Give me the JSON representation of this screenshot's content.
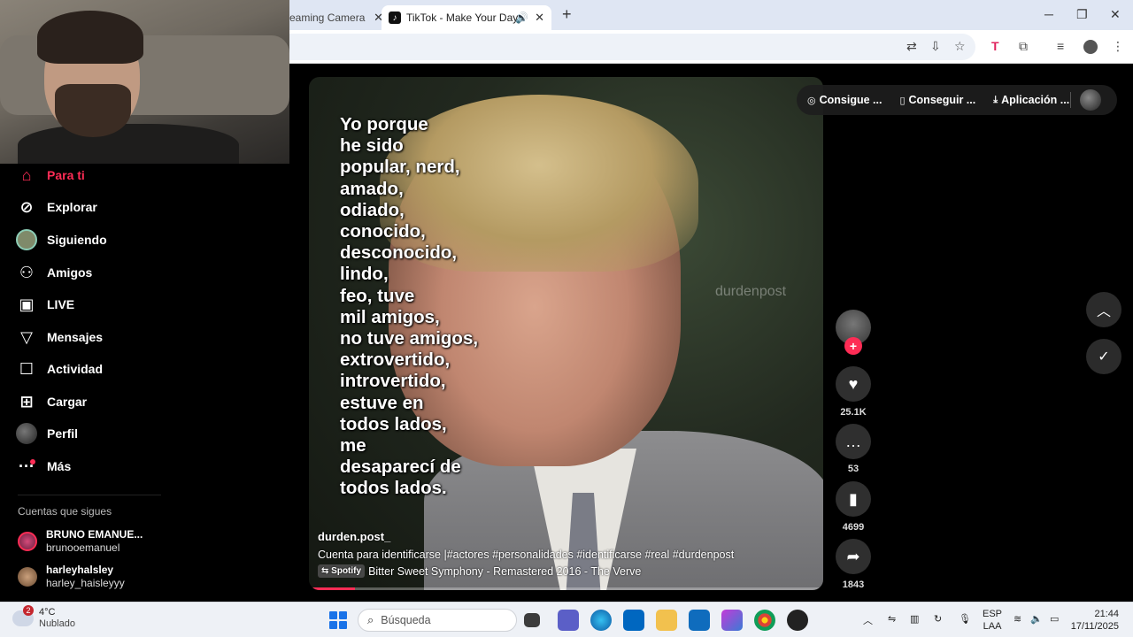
{
  "browser": {
    "tabs": [
      {
        "label": "eaming Camera",
        "active": false
      },
      {
        "label": "TikTok - Make Your Day",
        "active": true
      }
    ],
    "new_tab": "+",
    "window_controls": [
      "─",
      "❐",
      "✕"
    ]
  },
  "sidebar": {
    "items": [
      {
        "label": "Para ti",
        "icon": "home-icon"
      },
      {
        "label": "Explorar",
        "icon": "compass-icon"
      },
      {
        "label": "Siguiendo",
        "icon": "following-avatar"
      },
      {
        "label": "Amigos",
        "icon": "friends-icon"
      },
      {
        "label": "LIVE",
        "icon": "live-icon"
      },
      {
        "label": "Mensajes",
        "icon": "messages-icon"
      },
      {
        "label": "Actividad",
        "icon": "activity-icon"
      },
      {
        "label": "Cargar",
        "icon": "upload-icon"
      },
      {
        "label": "Perfil",
        "icon": "profile-avatar"
      },
      {
        "label": "Más",
        "icon": "more-icon"
      }
    ],
    "following_title": "Cuentas que sigues",
    "following": [
      {
        "name": "BRUNO EMANUE...",
        "handle": "brunooemanuel"
      },
      {
        "name": "harleyhalsley",
        "handle": "harley_haisleyyy"
      }
    ]
  },
  "top_actions": {
    "items": [
      "Consigue ...",
      "Conseguir ...",
      "Aplicación ..."
    ]
  },
  "video": {
    "overlay_text": "Yo porque\nhe sido\npopular, nerd,\namado,\nodiado,\nconocido,\ndesconocido,\nlindo,\nfeo, tuve\nmil amigos,\nno tuve amigos,\nextrovertido,\nintrovertido,\nestuve en\ntodos lados,\nme\ndesaparecí de\ntodos lados.",
    "watermark": "durdenpost",
    "author": "durden.post_",
    "description": "Cuenta para identificarse |#actores  #personalidades  #identificarse  #real  #durdenpost",
    "music_tag": "Spotify",
    "music": "Bitter Sweet Symphony - Remastered 2016 - The Verve",
    "progress": 0.09
  },
  "actions": {
    "likes": "25.1K",
    "comments": "53",
    "saves": "4699",
    "shares": "1843"
  },
  "taskbar": {
    "weather_badge": "2",
    "temperature": "4°C",
    "weather": "Nublado",
    "search_placeholder": "Búsqueda",
    "language": "ESP",
    "language_sub": "LAA",
    "time": "21:44",
    "date": "17/11/2025"
  },
  "colors": {
    "accent": "#fe2c55",
    "sidebar_bg": "#000000",
    "taskbar_bg": "#eef1f6"
  }
}
